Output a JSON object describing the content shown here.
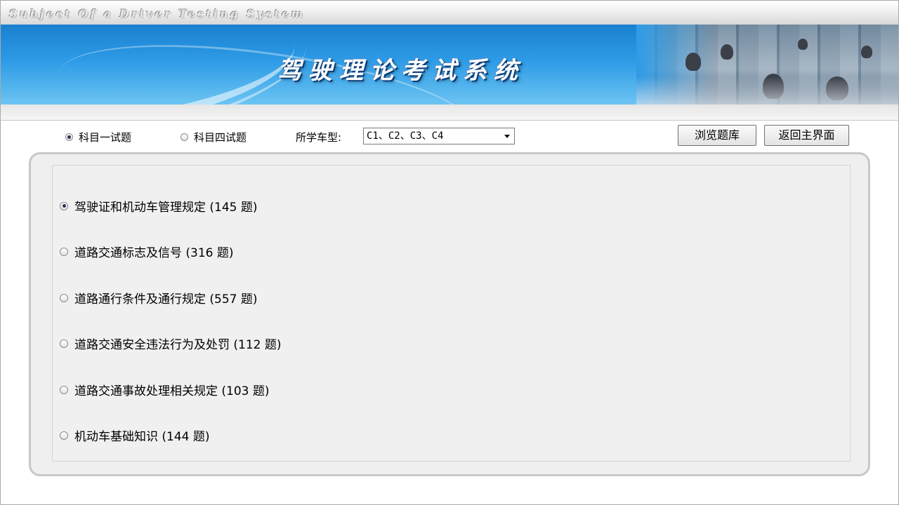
{
  "header": {
    "subtitle": "Subject Of a Driver Testing System",
    "title": "驾驶理论考试系统"
  },
  "toolbar": {
    "subject_one": {
      "label": "科目一试题",
      "checked": true
    },
    "subject_four": {
      "label": "科目四试题",
      "checked": false
    },
    "vehicle_type_label": "所学车型:",
    "vehicle_type_value": "C1、C2、C3、C4",
    "browse_button": "浏览题库",
    "return_button": "返回主界面"
  },
  "categories": [
    {
      "label": "驾驶证和机动车管理规定 (145 题)",
      "checked": true
    },
    {
      "label": "道路交通标志及信号 (316 题)",
      "checked": false
    },
    {
      "label": "道路通行条件及通行规定 (557 题)",
      "checked": false
    },
    {
      "label": "道路交通安全违法行为及处罚 (112 题)",
      "checked": false
    },
    {
      "label": "道路交通事故处理相关规定 (103 题)",
      "checked": false
    },
    {
      "label": "机动车基础知识 (144 题)",
      "checked": false
    }
  ],
  "colors": {
    "banner_blue": "#2d9be6",
    "panel_bg": "#f0f0f0",
    "border_gray": "#c8c8c8"
  }
}
